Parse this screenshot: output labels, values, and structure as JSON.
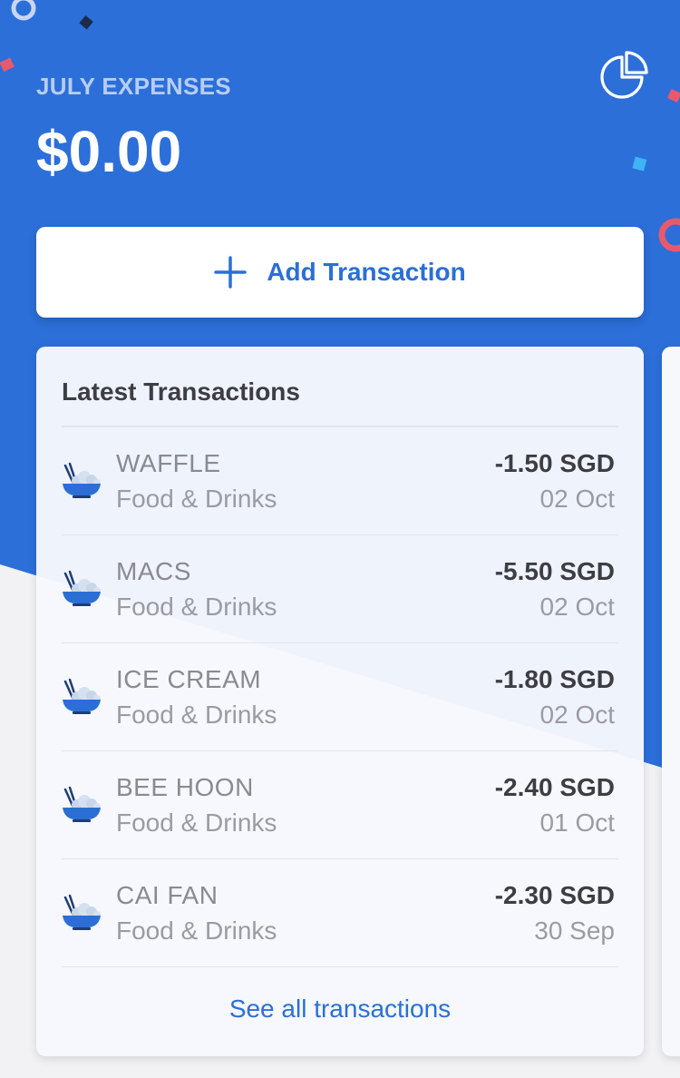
{
  "header": {
    "month_label": "JULY EXPENSES",
    "total": "$0.00",
    "chart_icon": "pie-chart-icon"
  },
  "add_transaction": {
    "label": "Add Transaction",
    "icon": "plus-icon"
  },
  "latest": {
    "title": "Latest Transactions",
    "transactions": [
      {
        "name": "WAFFLE",
        "category": "Food & Drinks",
        "amount": "-1.50 SGD",
        "date": "02 Oct",
        "icon": "rice-bowl-icon"
      },
      {
        "name": "MACS",
        "category": "Food & Drinks",
        "amount": "-5.50 SGD",
        "date": "02 Oct",
        "icon": "rice-bowl-icon"
      },
      {
        "name": "ICE CREAM",
        "category": "Food & Drinks",
        "amount": "-1.80 SGD",
        "date": "02 Oct",
        "icon": "rice-bowl-icon"
      },
      {
        "name": "BEE HOON",
        "category": "Food & Drinks",
        "amount": "-2.40 SGD",
        "date": "01 Oct",
        "icon": "rice-bowl-icon"
      },
      {
        "name": "CAI FAN",
        "category": "Food & Drinks",
        "amount": "-2.30 SGD",
        "date": "30 Sep",
        "icon": "rice-bowl-icon"
      }
    ],
    "see_all_label": "See all transactions"
  },
  "colors": {
    "primary": "#2b6fd6",
    "background_blue": "#2c6fd9",
    "text_dark": "#3d3d44",
    "text_muted": "#9b9ba2"
  }
}
